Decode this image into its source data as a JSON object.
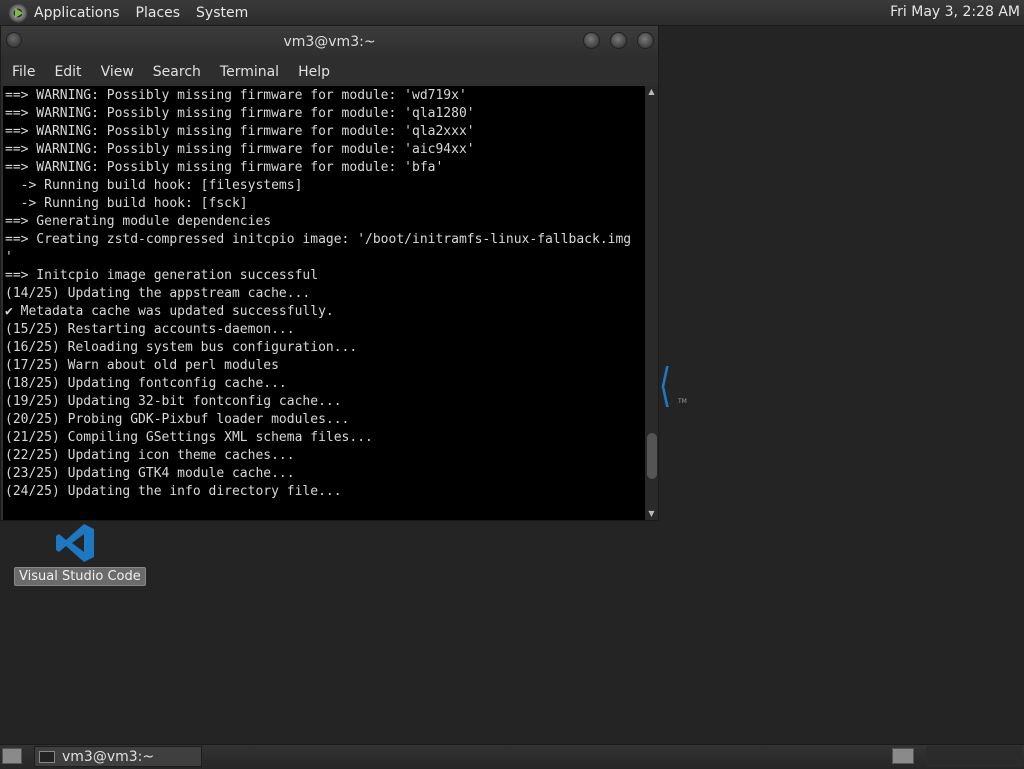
{
  "top_panel": {
    "menus": [
      "Applications",
      "Places",
      "System"
    ],
    "clock": "Fri May 3,  2:28 AM"
  },
  "desktop": {
    "icon_label": "Visual Studio Code",
    "background_mark": "⟨",
    "background_tm": "TM"
  },
  "window": {
    "title": "vm3@vm3:~",
    "menu": [
      "File",
      "Edit",
      "View",
      "Search",
      "Terminal",
      "Help"
    ],
    "terminal_lines": [
      "==> WARNING: Possibly missing firmware for module: 'wd719x'",
      "==> WARNING: Possibly missing firmware for module: 'qla1280'",
      "==> WARNING: Possibly missing firmware for module: 'qla2xxx'",
      "==> WARNING: Possibly missing firmware for module: 'aic94xx'",
      "==> WARNING: Possibly missing firmware for module: 'bfa'",
      "  -> Running build hook: [filesystems]",
      "  -> Running build hook: [fsck]",
      "==> Generating module dependencies",
      "==> Creating zstd-compressed initcpio image: '/boot/initramfs-linux-fallback.img",
      "'",
      "==> Initcpio image generation successful",
      "(14/25) Updating the appstream cache...",
      "✔ Metadata cache was updated successfully.",
      "(15/25) Restarting accounts-daemon...",
      "(16/25) Reloading system bus configuration...",
      "(17/25) Warn about old perl modules",
      "(18/25) Updating fontconfig cache...",
      "(19/25) Updating 32-bit fontconfig cache...",
      "(20/25) Probing GDK-Pixbuf loader modules...",
      "(21/25) Compiling GSettings XML schema files...",
      "(22/25) Updating icon theme caches...",
      "(23/25) Updating GTK4 module cache...",
      "(24/25) Updating the info directory file..."
    ],
    "scroll_position": 0.92
  },
  "bottom_panel": {
    "task_label": "vm3@vm3:~"
  },
  "colors": {
    "vscode_blue": "#1d78c1",
    "terminal_bg": "#000000",
    "desktop_bg": "#242424"
  }
}
